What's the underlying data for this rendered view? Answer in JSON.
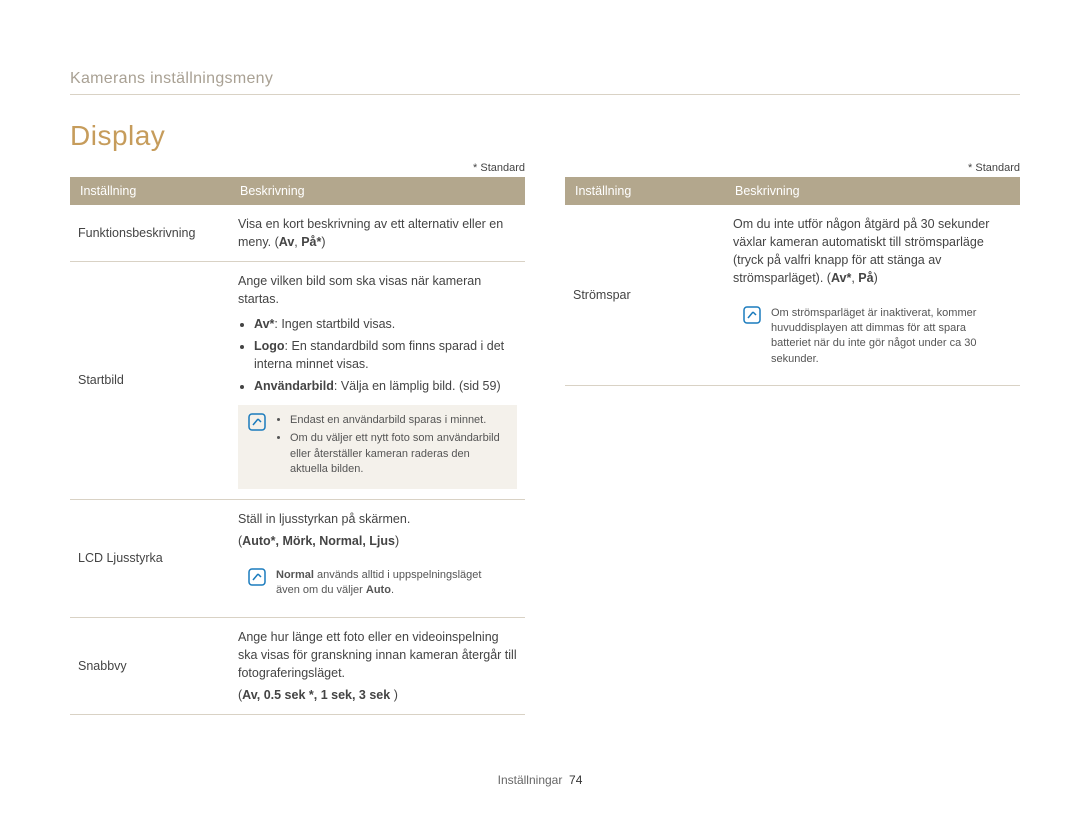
{
  "breadcrumb": "Kamerans inställningsmeny",
  "title": "Display",
  "std_marker": "* Standard",
  "headers": {
    "setting": "Inställning",
    "desc": "Beskrivning"
  },
  "left": [
    {
      "label": "Funktionsbeskrivning",
      "intro": "Visa en kort beskrivning av ett alternativ eller en meny. (",
      "opts_prefix": "Av",
      "opts_sep": ", ",
      "opts_suffix": "På*",
      "close": ")"
    },
    {
      "label": "Startbild",
      "intro": "Ange vilken bild som ska visas när kameran startas.",
      "bullets": [
        {
          "b": "Av*",
          "rest": ": Ingen startbild visas."
        },
        {
          "b": "Logo",
          "rest": ": En standardbild som finns sparad i det interna minnet visas."
        },
        {
          "b": "Användarbild",
          "rest": ": Välja en lämplig bild. (sid 59)"
        }
      ],
      "note": [
        "Endast en användarbild sparas i minnet.",
        "Om du väljer ett nytt foto som användarbild eller återställer kameran raderas den aktuella bilden."
      ]
    },
    {
      "label": "LCD Ljusstyrka",
      "intro": "Ställ in ljusstyrkan på skärmen.",
      "opts_line_open": "(",
      "opts_line": "Auto*, Mörk, Normal, Ljus",
      "opts_line_close": ")",
      "note_rich": {
        "b": "Normal",
        "mid": " används alltid i uppspelningsläget även om du väljer ",
        "b2": "Auto",
        "end": "."
      }
    },
    {
      "label": "Snabbvy",
      "intro": "Ange hur länge ett foto eller en videoinspelning ska visas för granskning innan kameran återgår till fotograferingsläget.",
      "opts_line_open": "(",
      "opts_line": "Av, 0.5 sek *, 1 sek, 3 sek ",
      "opts_line_close": ")"
    }
  ],
  "right": [
    {
      "label": "Strömspar",
      "intro_pre": "Om du inte utför någon åtgärd på 30 sekunder växlar kameran automatiskt till strömsparläge (tryck på valfri knapp för att stänga av strömsparläget). (",
      "opt1": "Av*",
      "sep": ", ",
      "opt2": "På",
      "close": ")",
      "note_text": "Om strömsparläget är inaktiverat, kommer huvuddisplayen att dimmas för att spara batteriet när du inte gör något under ca 30 sekunder."
    }
  ],
  "footer": {
    "label": "Inställningar",
    "page": "74"
  }
}
